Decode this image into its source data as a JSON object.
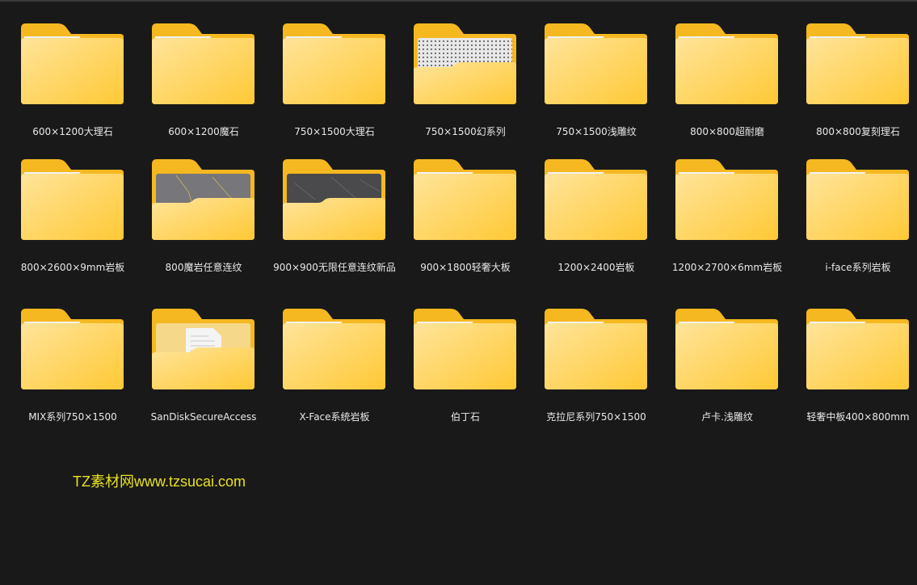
{
  "folders": [
    {
      "name": "600×1200大理石",
      "preview": "none"
    },
    {
      "name": "600×1200魔石",
      "preview": "none"
    },
    {
      "name": "750×1500大理石",
      "preview": "none"
    },
    {
      "name": "750×1500幻系列",
      "preview": "dots"
    },
    {
      "name": "750×1500浅雕纹",
      "preview": "none"
    },
    {
      "name": "800×800超耐磨",
      "preview": "none"
    },
    {
      "name": "800×800复刻理石",
      "preview": "none"
    },
    {
      "name": "800×2600×9mm岩板",
      "preview": "none"
    },
    {
      "name": "800魔岩任意连纹",
      "preview": "stone-gray"
    },
    {
      "name": "900×900无限任意连纹新品",
      "preview": "stone-dark"
    },
    {
      "name": "900×1800轻奢大板",
      "preview": "none"
    },
    {
      "name": "1200×2400岩板",
      "preview": "none"
    },
    {
      "name": "1200×2700×6mm岩板",
      "preview": "none"
    },
    {
      "name": "i-face系列岩板",
      "preview": "none"
    },
    {
      "name": "MIX系列750×1500",
      "preview": "none"
    },
    {
      "name": "SanDiskSecureAccess",
      "preview": "document"
    },
    {
      "name": "X-Face系统岩板",
      "preview": "none"
    },
    {
      "name": "伯丁石",
      "preview": "none"
    },
    {
      "name": "克拉尼系列750×1500",
      "preview": "none"
    },
    {
      "name": "卢卡.浅雕纹",
      "preview": "none"
    },
    {
      "name": "轻奢中板400×800mm",
      "preview": "none"
    }
  ],
  "watermark": "TZ素材网www.tzsucai.com",
  "colors": {
    "background": "#191919",
    "folder_back": "#f5b820",
    "folder_front_light": "#ffe49a",
    "folder_front_dark": "#ffc935",
    "watermark": "#e8e21a"
  }
}
